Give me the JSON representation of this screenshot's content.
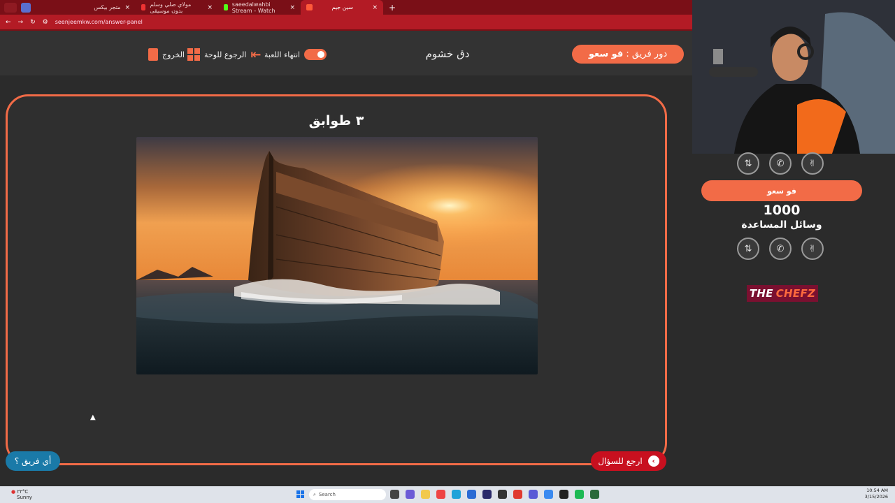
{
  "browser": {
    "tabs": [
      {
        "label": "متجر بيكس"
      },
      {
        "label": "مولاي صلي وسلم بدون موسيقى"
      },
      {
        "label": "saeedalwahbi Stream - Watch"
      },
      {
        "label": "سين جيم"
      }
    ],
    "url": "seenjeemkw.com/answer-panel"
  },
  "header": {
    "turn_prefix": "دور فريق :",
    "turn_team": "فو سعو",
    "game_title": "دق خشوم",
    "end_game_label": "انتهاء اللعبة",
    "back_to_board_label": "الرجوع للوحة",
    "exit_label": "الخروج"
  },
  "question": {
    "title": "٣ طوابق"
  },
  "buttons": {
    "back_to_question": "ارجع للسؤال",
    "which_team": "أي فريق ؟"
  },
  "sidebar": {
    "team_name": "فو سعو",
    "score": "1000",
    "aids_label": "وسائل المساعدة",
    "logo_left": "THE",
    "logo_right": "CHEFZ"
  },
  "taskbar": {
    "weather_temp": "٢٢°C",
    "weather_cond": "Sunny",
    "search_placeholder": "Search",
    "time": "10:54 AM",
    "date": "3/15/2026"
  },
  "colors": {
    "accent": "#f26b47",
    "danger": "#c8101f",
    "info": "#1a7aa8",
    "browser": "#b31b25"
  }
}
